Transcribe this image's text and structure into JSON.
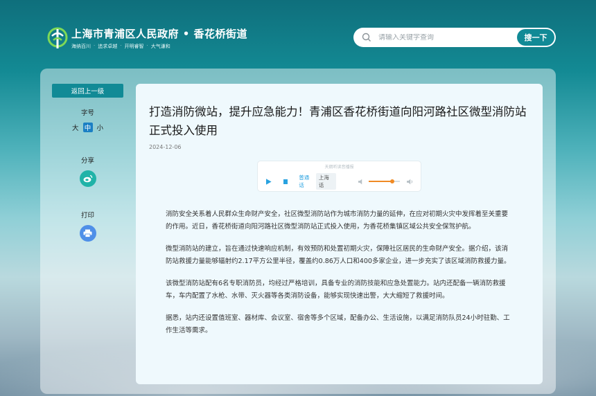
{
  "header": {
    "site_title": "上海市青浦区人民政府 • 香花桥街道",
    "slogan": [
      "海纳百川",
      "追求卓越",
      "开明睿智",
      "大气谦和"
    ],
    "search_placeholder": "请输入关键字查询",
    "search_button": "搜一下"
  },
  "sidebar": {
    "back_label": "返回上一级",
    "font_size_label": "字号",
    "font_sizes": [
      "大",
      "中",
      "小"
    ],
    "share_label": "分享",
    "print_label": "打印"
  },
  "article": {
    "title": "打造消防微站，提升应急能力！青浦区香花桥街道向阳河路社区微型消防站正式投入使用",
    "date": "2024-12-06",
    "player": {
      "title": "天朗听读音播报",
      "lang_mandarin": "普通话",
      "lang_shanghai": "上海话",
      "volume": 0.75
    },
    "paragraphs": [
      "消防安全关系着人民群众生命财产安全，社区微型消防站作为城市消防力量的延伸，在应对初期火灾中发挥着至关重要的作用。近日，香花桥街道向阳河路社区微型消防站正式投入使用，为香花桥集镇区域公共安全保驾护航。",
      "微型消防站的建立，旨在通过快速响应机制，有效预防和处置初期火灾，保障社区居民的生命财产安全。据介绍，该消防站救援力量能够辐射约2.17平方公里半径，覆盖约0.86万人口和400多家企业，进一步充实了该区域消防救援力量。",
      "该微型消防站配有6名专职消防员，均经过严格培训，具备专业的消防技能和应急处置能力。站内还配备一辆消防救援车，车内配置了水枪、水带、灭火器等各类消防设备，能够实现快速出警，大大缩短了救援时间。",
      "据悉，站内还设置值班室、器材库、会议室、宿舍等多个区域，配备办公、生活设施，以满足消防队员24小时驻勤、工作生活等需求。"
    ]
  },
  "colors": {
    "accent": "#118a96",
    "active_font": "#1b7fc4",
    "player_blue": "#29a2e0",
    "volume_orange": "#f08a24"
  }
}
